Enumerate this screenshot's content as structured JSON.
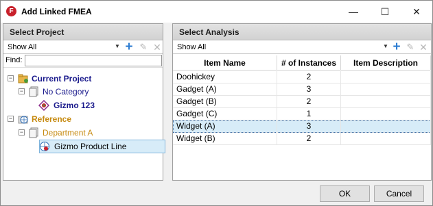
{
  "window": {
    "title": "Add Linked FMEA",
    "app_icon_letter": "F",
    "minimize_glyph": "—",
    "maximize_glyph": "☐",
    "close_glyph": "✕"
  },
  "left_panel": {
    "header": "Select Project",
    "filter_value": "Show All",
    "find_label": "Find:",
    "find_value": "",
    "tree": [
      {
        "label": "Current Project",
        "expander": "−",
        "icon": "project-folder-icon"
      },
      {
        "label": "No Category",
        "expander": "−",
        "icon": "category-icon"
      },
      {
        "label": "Gizmo 123",
        "icon": "fmea-project-icon"
      },
      {
        "label": "Reference",
        "expander": "−",
        "icon": "reference-globe-icon"
      },
      {
        "label": "Department A",
        "expander": "−",
        "icon": "category-icon"
      },
      {
        "label": "Gizmo Product Line",
        "icon": "reference-project-icon",
        "selected": true
      }
    ]
  },
  "right_panel": {
    "header": "Select Analysis",
    "filter_value": "Show All",
    "columns": [
      "Item Name",
      "# of Instances",
      "Item Description"
    ],
    "rows": [
      {
        "name": "Doohickey",
        "instances": "2",
        "description": ""
      },
      {
        "name": "Gadget (A)",
        "instances": "3",
        "description": ""
      },
      {
        "name": "Gadget (B)",
        "instances": "2",
        "description": ""
      },
      {
        "name": "Gadget (C)",
        "instances": "1",
        "description": ""
      },
      {
        "name": "Widget (A)",
        "instances": "3",
        "description": "",
        "selected": true
      },
      {
        "name": "Widget (B)",
        "instances": "2",
        "description": ""
      }
    ]
  },
  "buttons": {
    "ok": "OK",
    "cancel": "Cancel"
  },
  "colors": {
    "accent_blue": "#2d7dd2",
    "selection": "#d7ecf8",
    "current_project": "#1a1a8c",
    "reference": "#c68a10",
    "brand_red": "#c8202b"
  }
}
